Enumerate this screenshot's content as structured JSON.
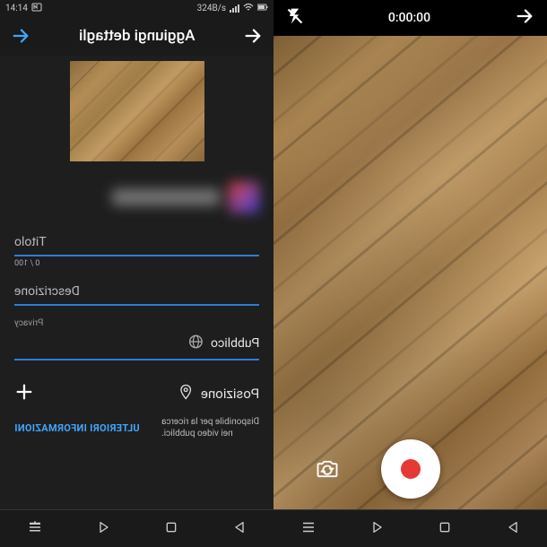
{
  "statusbar": {
    "time": "14:14",
    "speed": "324B/s"
  },
  "details": {
    "header_title": "Aggiungi dettagli",
    "title_placeholder": "Titolo",
    "title_counter": "0 / 100",
    "description_placeholder": "Descrizione",
    "privacy_label": "Privacy",
    "privacy_value": "Pubblico",
    "location_label": "Posizione",
    "footer_text_line1": "Disponibile per la ricerca",
    "footer_text_line2": "nei video pubblici.",
    "footer_link": "ULTERIORI INFORMAZIONI"
  },
  "camera": {
    "timer": "0:00:00"
  }
}
